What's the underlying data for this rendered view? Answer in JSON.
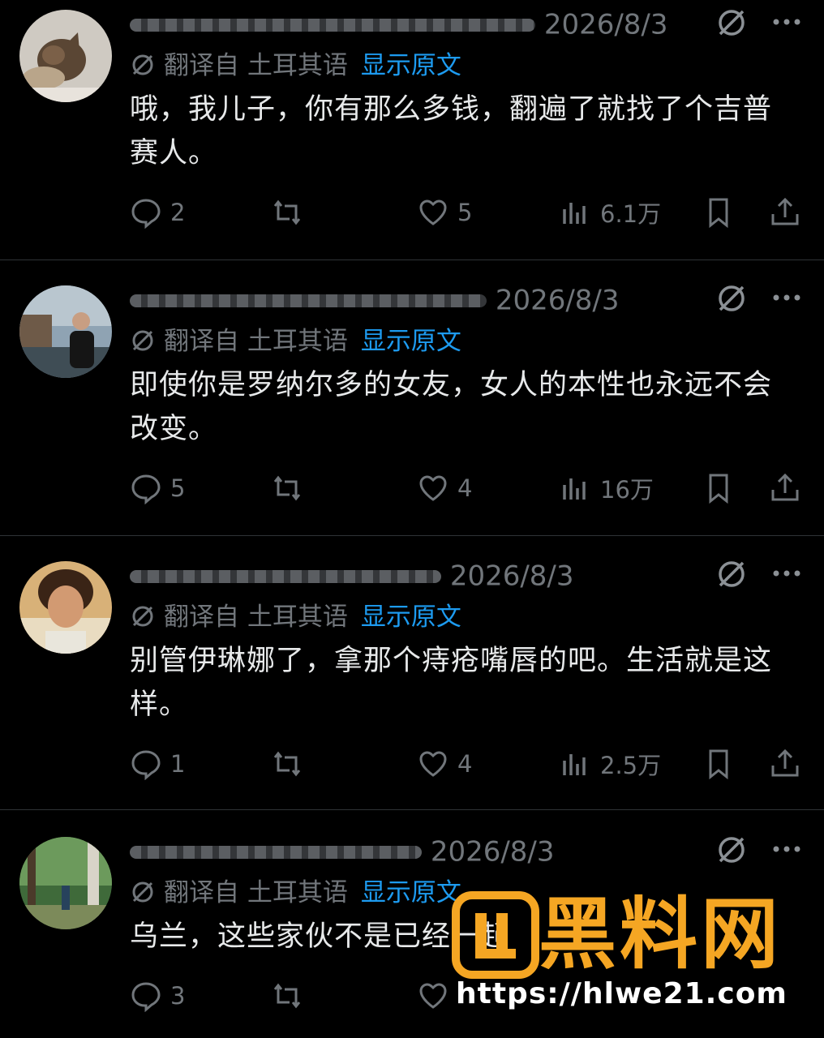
{
  "posts": [
    {
      "date": "2026/8/3",
      "translated_from": "翻译自 土耳其语",
      "show_original": "显示原文",
      "text": "哦，我儿子，你有那么多钱，翻遍了就找了个吉普赛人。",
      "replies": "2",
      "likes": "5",
      "views": "6.1万",
      "avatar_icon": "cat-avatar"
    },
    {
      "date": "2026/8/3",
      "translated_from": "翻译自 土耳其语",
      "show_original": "显示原文",
      "text": "即使你是罗纳尔多的女友，女人的本性也永远不会改变。",
      "replies": "5",
      "likes": "4",
      "views": "16万",
      "avatar_icon": "man-by-canal-avatar"
    },
    {
      "date": "2026/8/3",
      "translated_from": "翻译自 土耳其语",
      "show_original": "显示原文",
      "text": "别管伊琳娜了，拿那个痔疮嘴唇的吧。生活就是这样。",
      "replies": "1",
      "likes": "4",
      "views": "2.5万",
      "avatar_icon": "cartoon-boy-avatar"
    },
    {
      "date": "2026/8/3",
      "translated_from": "翻译自 土耳其语",
      "show_original": "显示原文",
      "text": "乌兰，这些家伙不是已经一起",
      "replies": "3",
      "likes": "",
      "views": "",
      "avatar_icon": "forest-avatar"
    }
  ],
  "watermark": {
    "brand": "黑料网",
    "url": "https://hlwe21.com",
    "color": "#f5a623"
  },
  "colors": {
    "background": "#000000",
    "text": "#e7e9ea",
    "muted": "#71767b",
    "link": "#1d9bf0",
    "divider": "#2f3336"
  }
}
